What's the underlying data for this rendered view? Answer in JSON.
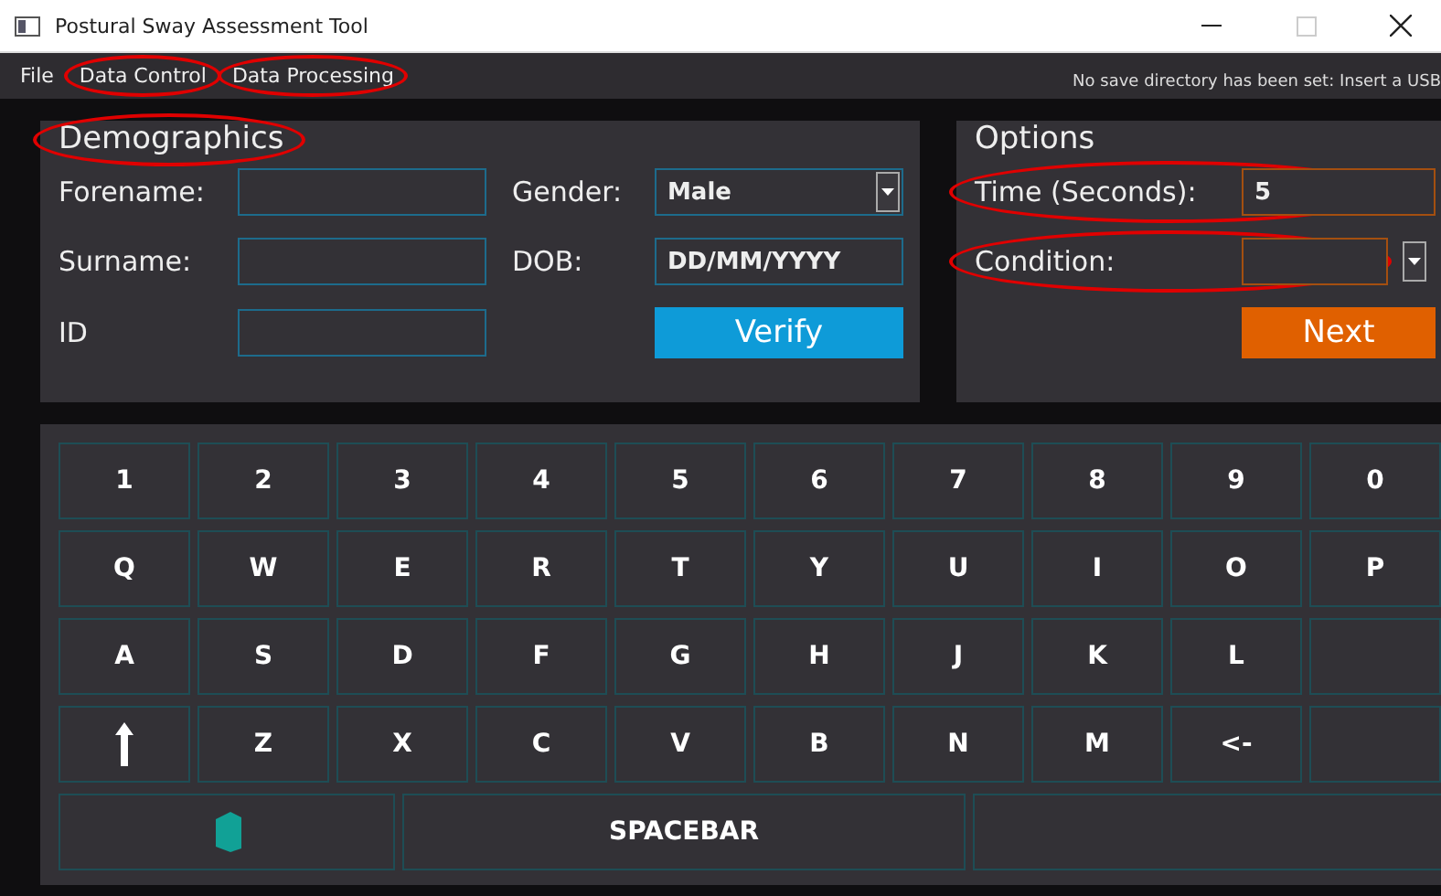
{
  "window": {
    "title": "Postural Sway Assessment Tool"
  },
  "menu": [
    {
      "label": "File",
      "circled": false
    },
    {
      "label": "Data Control",
      "circled": true
    },
    {
      "label": "Data Processing",
      "circled": true
    }
  ],
  "status_message": "No save directory has been set: Insert a USB",
  "demographics": {
    "title": "Demographics",
    "circled": true,
    "forename": {
      "label": "Forename:"
    },
    "surname": {
      "label": "Surname:"
    },
    "id": {
      "label": "ID"
    },
    "gender": {
      "label": "Gender:",
      "value": "Male"
    },
    "dob": {
      "label": "DOB:",
      "value": "DD/MM/YYYY"
    },
    "verify_button": "Verify"
  },
  "options": {
    "title": "Options",
    "circled": false,
    "time": {
      "label": "Time (Seconds):",
      "value": "5",
      "circled": true
    },
    "condition": {
      "label": "Condition:",
      "circled": true
    },
    "next_button": "Next"
  },
  "keyboard": {
    "rows": [
      [
        {
          "kind": "text",
          "label": "1"
        },
        {
          "kind": "text",
          "label": "2"
        },
        {
          "kind": "text",
          "label": "3"
        },
        {
          "kind": "text",
          "label": "4"
        },
        {
          "kind": "text",
          "label": "5"
        },
        {
          "kind": "text",
          "label": "6"
        },
        {
          "kind": "text",
          "label": "7"
        },
        {
          "kind": "text",
          "label": "8"
        },
        {
          "kind": "text",
          "label": "9"
        },
        {
          "kind": "text",
          "label": "0"
        }
      ],
      [
        {
          "kind": "text",
          "label": "Q"
        },
        {
          "kind": "text",
          "label": "W"
        },
        {
          "kind": "text",
          "label": "E"
        },
        {
          "kind": "text",
          "label": "R"
        },
        {
          "kind": "text",
          "label": "T"
        },
        {
          "kind": "text",
          "label": "Y"
        },
        {
          "kind": "text",
          "label": "U"
        },
        {
          "kind": "text",
          "label": "I"
        },
        {
          "kind": "text",
          "label": "O"
        },
        {
          "kind": "text",
          "label": "P"
        }
      ],
      [
        {
          "kind": "text",
          "label": "A"
        },
        {
          "kind": "text",
          "label": "S"
        },
        {
          "kind": "text",
          "label": "D"
        },
        {
          "kind": "text",
          "label": "F"
        },
        {
          "kind": "text",
          "label": "G"
        },
        {
          "kind": "text",
          "label": "H"
        },
        {
          "kind": "text",
          "label": "J"
        },
        {
          "kind": "text",
          "label": "K"
        },
        {
          "kind": "text",
          "label": "L"
        },
        {
          "kind": "blank"
        }
      ],
      [
        {
          "kind": "shift"
        },
        {
          "kind": "text",
          "label": "Z"
        },
        {
          "kind": "text",
          "label": "X"
        },
        {
          "kind": "text",
          "label": "C"
        },
        {
          "kind": "text",
          "label": "V"
        },
        {
          "kind": "text",
          "label": "B"
        },
        {
          "kind": "text",
          "label": "N"
        },
        {
          "kind": "text",
          "label": "M"
        },
        {
          "kind": "text",
          "label": "<-"
        },
        {
          "kind": "blank"
        }
      ]
    ],
    "bottom_row": [
      {
        "kind": "logo"
      },
      {
        "kind": "text",
        "label": "SPACEBAR"
      },
      {
        "kind": "blank"
      }
    ]
  }
}
